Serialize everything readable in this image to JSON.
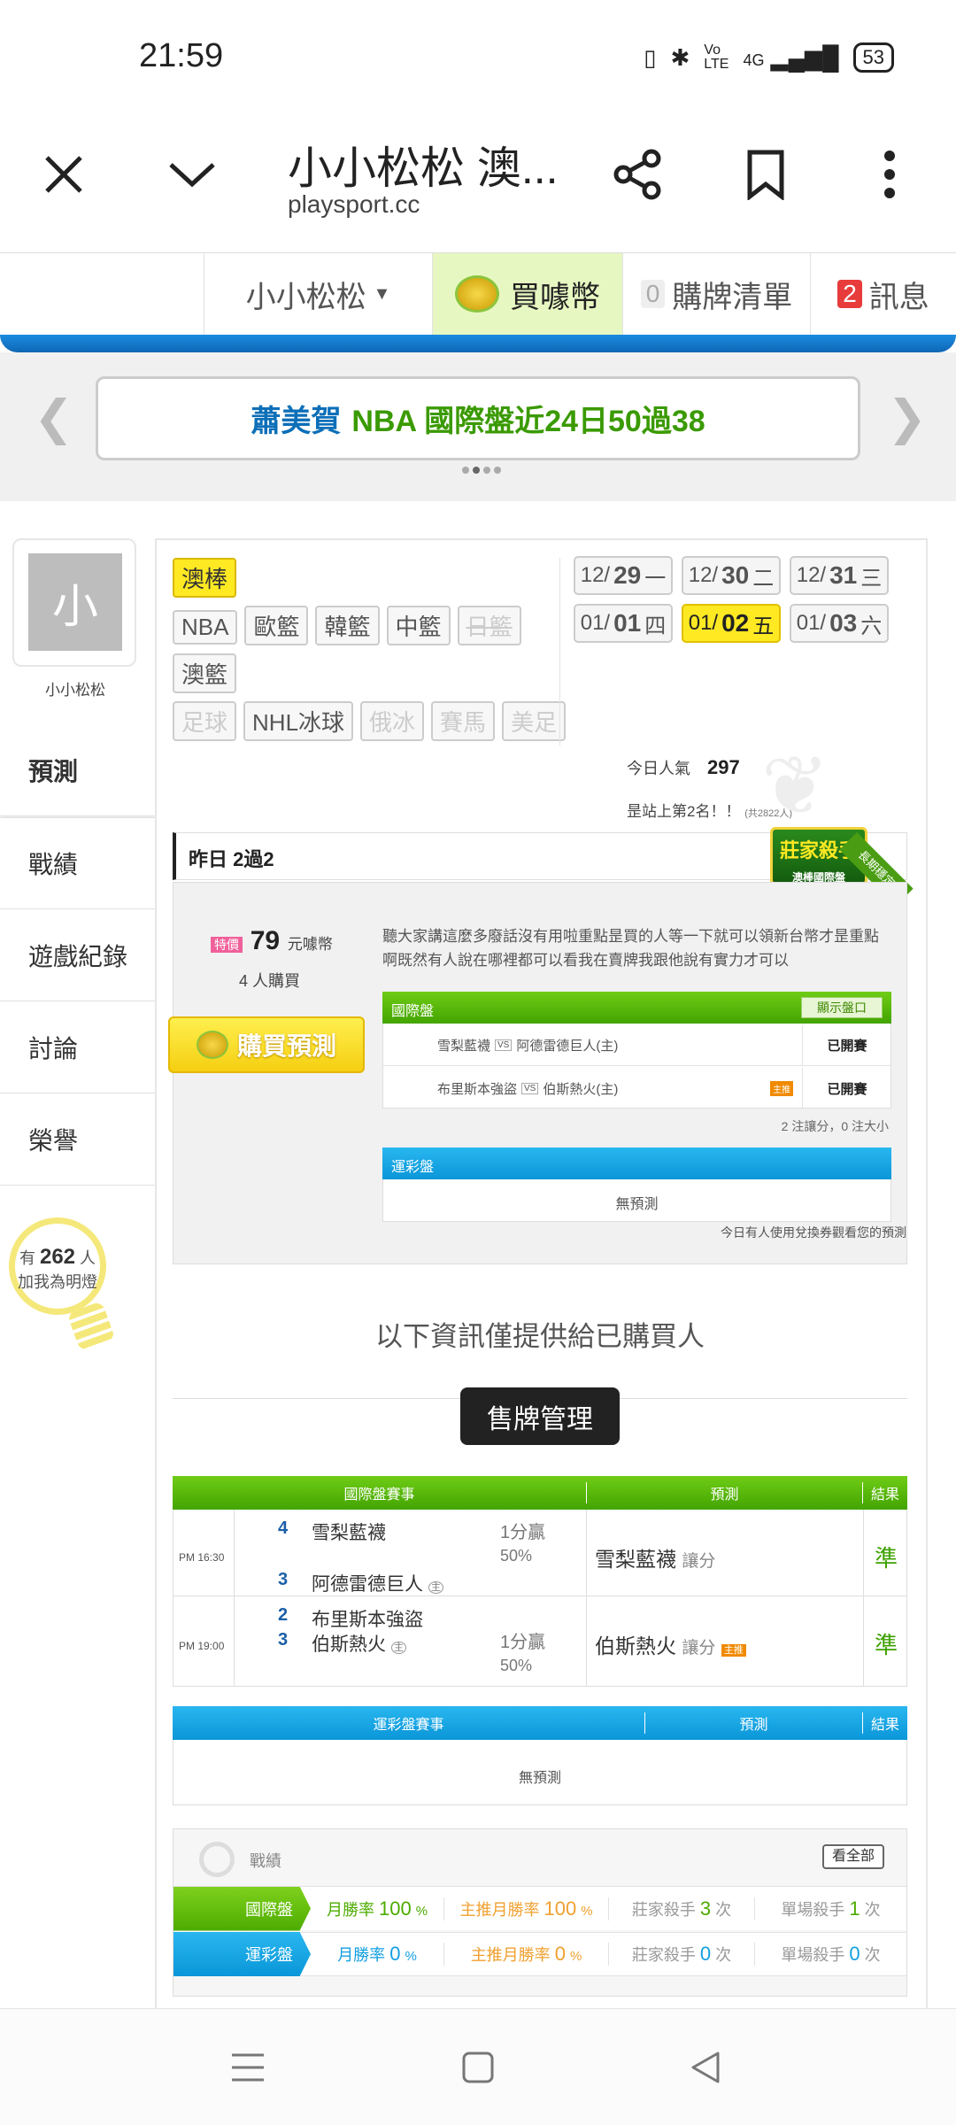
{
  "status_bar": {
    "time": "21:59",
    "signal": "4G",
    "battery": "53"
  },
  "browser": {
    "title": "小小松松 澳...",
    "url": "playsport.cc",
    "close_icon": "close-icon",
    "expand_icon": "chevron-down-icon",
    "share_icon": "share-icon",
    "bookmark_icon": "bookmark-icon",
    "menu_icon": "more-vert-icon"
  },
  "site_nav": {
    "user": "小小松松",
    "buy_coin": "買噱幣",
    "list_count": "0",
    "list_label": "購牌清單",
    "msg_count": "2",
    "msg_label": "訊息"
  },
  "banner": {
    "name": "蕭美賀",
    "text": "NBA 國際盤近24日50過38"
  },
  "profile": {
    "avatar_letter": "小",
    "name": "小小松松"
  },
  "sidebar": {
    "items": [
      "預測",
      "戰績",
      "遊戲紀錄",
      "討論",
      "榮譽"
    ],
    "fans_prefix": "有",
    "fans_count": "262",
    "fans_unit": "人",
    "fans_text": "加我為明燈"
  },
  "sports": {
    "active": "澳棒",
    "row1": [
      "NBA",
      "歐籃",
      "韓籃",
      "中籃",
      "日籃"
    ],
    "row2": [
      "澳籃"
    ],
    "row3": [
      "足球",
      "NHL冰球",
      "俄冰",
      "賽馬",
      "美足"
    ]
  },
  "dates": [
    {
      "month": "12/",
      "day": "29",
      "wd": "一"
    },
    {
      "month": "12/",
      "day": "30",
      "wd": "二"
    },
    {
      "month": "12/",
      "day": "31",
      "wd": "三"
    },
    {
      "month": "01/",
      "day": "01",
      "wd": "四"
    },
    {
      "month": "01/",
      "day": "02",
      "wd": "五"
    },
    {
      "month": "01/",
      "day": "03",
      "wd": "六"
    }
  ],
  "popularity": {
    "label": "今日人氣",
    "value": "297",
    "rank": "昰站上第2名！！",
    "rank_total": "(共2822人)"
  },
  "yesterday": {
    "label": "昨日 2過2",
    "badge_title": "莊家殺手",
    "badge_sub": "澳棒國際盤",
    "badge_ribbon": "長期穩定"
  },
  "purchase": {
    "special_tag": "特價",
    "price": "79",
    "price_unit": "元噱幣",
    "buyers": "4 人購買",
    "buy_button": "購買預測"
  },
  "desc": "聽大家講這麼多廢話沒有用啦重點昰買的人等一下就可以領新台幣才昰重點啊既然有人說在哪裡都可以看我在賣牌我跟他說有實力才可以",
  "intl_box": {
    "title": "國際盤",
    "show_btn": "顯示盤口",
    "rows": [
      {
        "away": "雪梨藍襪",
        "home": "阿德雷德巨人(主)",
        "status": "已開賽",
        "tag": ""
      },
      {
        "away": "布里斯本強盜",
        "home": "伯斯熱火(主)",
        "status": "已開賽",
        "tag": "主推"
      }
    ],
    "note": "2 注讓分，0 注大小"
  },
  "lottery_box": {
    "title": "運彩盤",
    "empty": "無預測"
  },
  "coupon_note": "今日有人使用兌換券觀看您的預測",
  "info_only": "以下資訊僅提供給已購買人",
  "manage_btn": "售牌管理",
  "intl_table": {
    "headers": [
      "國際盤賽事",
      "預測",
      "結果"
    ],
    "rows": [
      {
        "time": "PM 16:30",
        "away_score": "4",
        "away": "雪梨藍襪",
        "home_score": "3",
        "home": "阿德雷德巨人",
        "home_tag": "主",
        "line": "1分贏",
        "pct": "50%",
        "pick": "雪梨藍襪",
        "pick_type": "讓分",
        "pick_tag": "",
        "result": "準"
      },
      {
        "time": "PM 19:00",
        "away_score": "2",
        "away": "布里斯本強盜",
        "home_score": "3",
        "home": "伯斯熱火",
        "home_tag": "主",
        "line": "1分贏",
        "pct": "50%",
        "pick": "伯斯熱火",
        "pick_type": "讓分",
        "pick_tag": "主推",
        "result": "準"
      }
    ]
  },
  "lottery_table": {
    "headers": [
      "運彩盤賽事",
      "預測",
      "結果"
    ],
    "empty": "無預測"
  },
  "record": {
    "title": "戰績",
    "view_all": "看全部",
    "rows": [
      {
        "label": "國際盤",
        "month_label": "月勝率",
        "month": "100",
        "main_label": "主推月勝率",
        "main": "100",
        "dealer_label": "莊家殺手",
        "dealer": "3",
        "single_label": "單場殺手",
        "single": "1",
        "unit": "次"
      },
      {
        "label": "運彩盤",
        "month_label": "月勝率",
        "month": "0",
        "main_label": "主推月勝率",
        "main": "0",
        "dealer_label": "莊家殺手",
        "dealer": "0",
        "single_label": "單場殺手",
        "single": "0",
        "unit": "次"
      }
    ]
  },
  "colors": {
    "green": "#52b300",
    "blue": "#129fe0",
    "orange": "#f08a00",
    "yellow": "#ffe923"
  }
}
